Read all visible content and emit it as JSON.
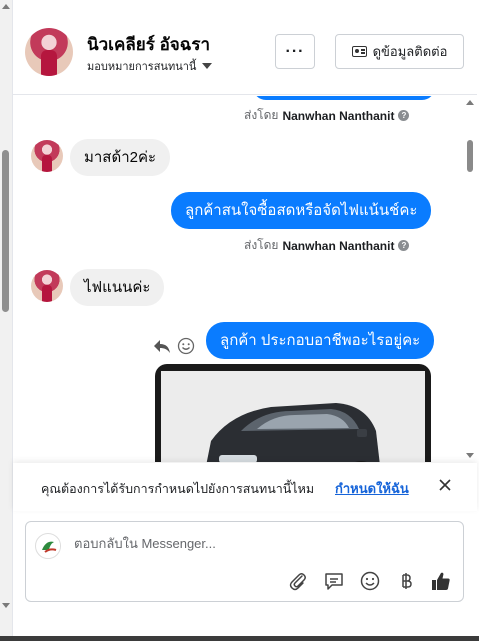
{
  "header": {
    "contact_name": "นิวเคลียร์ อัจฉรา",
    "assign_label": "มอบหมายการสนทนานี้",
    "more_label": "···",
    "contact_info_label": "ดูข้อมูลติดต่อ"
  },
  "messages": [
    {
      "direction": "out",
      "sent_by_prefix": "ส่งโดย",
      "sent_by_name": "Nanwhan Nanthanit"
    },
    {
      "direction": "in",
      "text": "มาสด้า2ค่ะ"
    },
    {
      "direction": "out",
      "text": "ลูกค้าสนใจซื้อสดหรือจัดไฟแน้นช์คะ",
      "sent_by_prefix": "ส่งโดย",
      "sent_by_name": "Nanwhan Nanthanit"
    },
    {
      "direction": "in",
      "text": "ไฟแนนค่ะ"
    },
    {
      "direction": "out",
      "text": "ลูกค้า ประกอบอาชีพอะไรอยู่คะ"
    },
    {
      "direction": "out",
      "type": "image",
      "alt": "car-photo"
    }
  ],
  "notice": {
    "text": "คุณต้องการได้รับการกำหนดไปยังการสนทนานี้ไหม",
    "link": "กำหนดให้ฉัน"
  },
  "composer": {
    "placeholder": "ตอบกลับใน Messenger..."
  },
  "icons": [
    "chevron-down-icon",
    "id-card-icon",
    "help-icon",
    "reply-icon",
    "smile-icon",
    "close-icon",
    "attachment-icon",
    "saved-reply-icon",
    "emoji-icon",
    "baht-icon",
    "like-icon"
  ],
  "colors": {
    "accent": "#0a7cff",
    "link": "#1664d9",
    "incoming_bubble": "#f0f0f0"
  }
}
